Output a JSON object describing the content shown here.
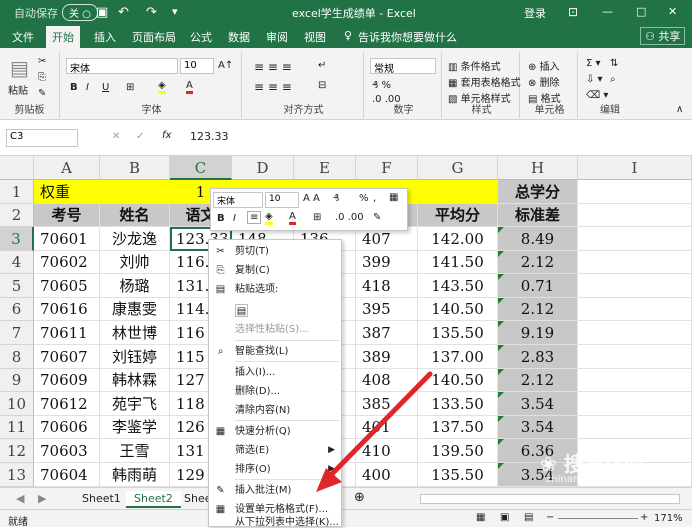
{
  "titlebar": {
    "autosave_label": "自动保存",
    "autosave_state": "关",
    "title": "excel学生成绩单 - Excel",
    "login": "登录",
    "minimize": "—",
    "restore": "□",
    "close": "✕"
  },
  "tabs": {
    "file": "文件",
    "home": "开始",
    "insert": "插入",
    "layout": "页面布局",
    "formulas": "公式",
    "data": "数据",
    "review": "审阅",
    "view": "视图",
    "tellme": "告诉我你想要做什么",
    "share": "共享"
  },
  "ribbon": {
    "paste_label": "粘贴",
    "clipboard_group": "剪贴板",
    "font_name": "宋体",
    "font_size": "10",
    "font_group": "字体",
    "align_group": "对齐方式",
    "number_format": "常规",
    "number_group": "数字",
    "cond_format": "条件格式",
    "table_format": "套用表格格式",
    "cell_style": "单元格样式",
    "style_group": "样式",
    "insert_btn": "插入",
    "delete_btn": "删除",
    "format_btn": "格式",
    "cells_group": "单元格",
    "edit_group": "编辑"
  },
  "formula_bar": {
    "name_box": "C3",
    "fx": "fx",
    "value": "123.33"
  },
  "columns": [
    "A",
    "B",
    "C",
    "D",
    "E",
    "F",
    "G",
    "H",
    "I"
  ],
  "rows": [
    "1",
    "2",
    "3",
    "4",
    "5",
    "6",
    "7",
    "8",
    "9",
    "10",
    "11",
    "12",
    "13",
    "14"
  ],
  "row1": {
    "weight": "权重",
    "c1": "1",
    "h1": "总学分"
  },
  "headers": {
    "a": "考号",
    "b": "姓名",
    "c": "语文",
    "g": "平均分",
    "h": "标准差"
  },
  "data_rows": [
    {
      "id": "70601",
      "name": "沙龙逸",
      "c": "123.33",
      "d": "148",
      "e": "136",
      "f": "407",
      "g": "142.00",
      "h": "8.49"
    },
    {
      "id": "70602",
      "name": "刘帅",
      "c": "116.",
      "d": "",
      "e": "",
      "f": "399",
      "g": "141.50",
      "h": "2.12"
    },
    {
      "id": "70605",
      "name": "杨璐",
      "c": "131.",
      "d": "",
      "e": "",
      "f": "418",
      "g": "143.50",
      "h": "0.71"
    },
    {
      "id": "70616",
      "name": "康惠雯",
      "c": "114.",
      "d": "",
      "e": "",
      "f": "395",
      "g": "140.50",
      "h": "2.12"
    },
    {
      "id": "70611",
      "name": "林世博",
      "c": "116",
      "d": "",
      "e": "",
      "f": "387",
      "g": "135.50",
      "h": "9.19"
    },
    {
      "id": "70607",
      "name": "刘钰婷",
      "c": "115",
      "d": "",
      "e": "",
      "f": "389",
      "g": "137.00",
      "h": "2.83"
    },
    {
      "id": "70609",
      "name": "韩林霖",
      "c": "127",
      "d": "",
      "e": "",
      "f": "408",
      "g": "140.50",
      "h": "2.12"
    },
    {
      "id": "70612",
      "name": "苑宇飞",
      "c": "118",
      "d": "",
      "e": "",
      "f": "385",
      "g": "133.50",
      "h": "3.54"
    },
    {
      "id": "70606",
      "name": "李鉴学",
      "c": "126",
      "d": "",
      "e": "",
      "f": "401",
      "g": "137.50",
      "h": "3.54"
    },
    {
      "id": "70603",
      "name": "王雪",
      "c": "131",
      "d": "",
      "e": "",
      "f": "410",
      "g": "139.50",
      "h": "6.36"
    },
    {
      "id": "70604",
      "name": "韩雨萌",
      "c": "129",
      "d": "",
      "e": "",
      "f": "400",
      "g": "135.50",
      "h": "3.54"
    }
  ],
  "mini_toolbar": {
    "font": "宋体",
    "size": "10"
  },
  "context_menu": {
    "cut": "剪切(T)",
    "copy": "复制(C)",
    "paste_options": "粘贴选项:",
    "paste_special": "选择性粘贴(S)...",
    "smart_lookup": "智能查找(L)",
    "insert": "插入(I)...",
    "delete": "删除(D)...",
    "clear": "清除内容(N)",
    "quick_analysis": "快速分析(Q)",
    "filter": "筛选(E)",
    "sort": "排序(O)",
    "insert_comment": "插入批注(M)",
    "format_cells": "设置单元格格式(F)...",
    "pick_list": "从下拉列表中选择(K)..."
  },
  "sheets": [
    "Sheet1",
    "Sheet2",
    "Shee"
  ],
  "status": {
    "ready": "就绪",
    "zoom": "171%"
  },
  "watermark": {
    "text": "搜狗指南",
    "url": "zhinan.sogou.com"
  },
  "colors": {
    "excel_green": "#217346",
    "highlight_yellow": "#ffff00",
    "header_gray": "#c8c8c8",
    "arrow_red": "#e0262a"
  }
}
